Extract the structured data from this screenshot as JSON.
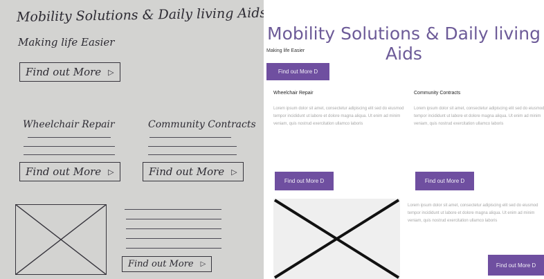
{
  "sketch": {
    "title": "Mobility Solutions & Daily living Aids",
    "subtitle": "Making life Easier",
    "button_label": "Find out More",
    "button_arrow": "▷",
    "col1_heading": "Wheelchair Repair",
    "col2_heading": "Community Contracts"
  },
  "mockup": {
    "title": "Mobility Solutions & Daily living Aids",
    "tagline": "Making life Easier",
    "hero_button": "Find out More D",
    "col1": {
      "heading": "Wheelchair Repair",
      "body": "Lorem ipsum dolor sit amet, consectetur adipiscing elit sed do eiusmod tempor incididunt ut labore et dolore magna aliqua. Ut enim ad minim veniam, quis nostrud exercitation ullamco laboris",
      "button": "Find out More D"
    },
    "col2": {
      "heading": "Community Contracts",
      "body": "Lorem ipsum dolor sit amet, consectetur adipiscing elit sed do eiusmod tempor incididunt ut labore et dolore magna aliqua. Ut enim ad minim veniam, quis nostrud exercitation ullamco laboris",
      "button": "Find out More D"
    },
    "feature": {
      "body": "Lorem ipsum dolor sit amet, consectetur adipiscing elit sed do eiusmod tempor incididunt ut labore et dolore magna aliqua. Ut enim ad minim veniam, quis nostrud exercitation ullamco laboris",
      "button": "Find out More D"
    }
  },
  "colors": {
    "accent": "#6f4fa0",
    "title": "#6d5b98",
    "body_text": "#a6a6a6",
    "paper": "#d3d3d1"
  },
  "icons": {
    "image_placeholder": "crossed-box-icon",
    "button_arrow": "triangle-right-icon"
  }
}
